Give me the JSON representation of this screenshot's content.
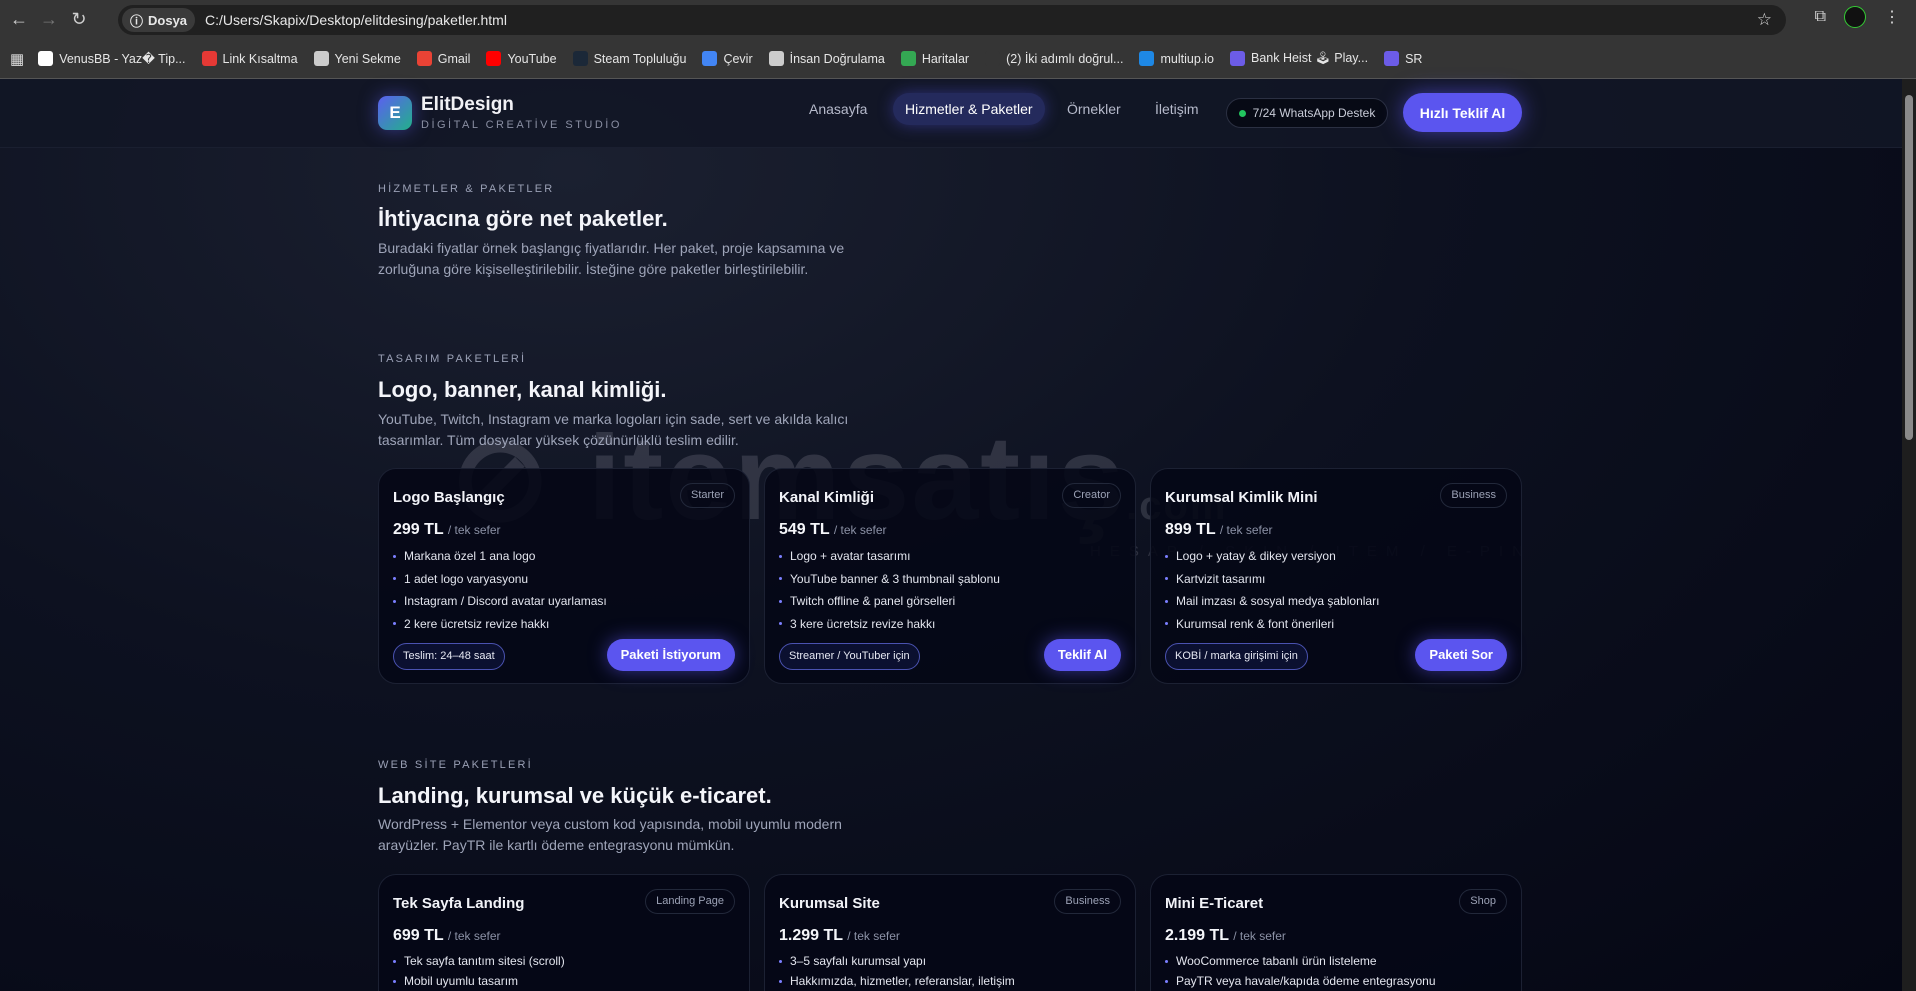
{
  "browser": {
    "chip": "Dosya",
    "url": "C:/Users/Skapix/Desktop/elitdesing/paketler.html",
    "bookmarks": [
      {
        "label": "VenusBB - Yaz� Tip...",
        "color": "#ffffff"
      },
      {
        "label": "Link Kısaltma",
        "color": "#e53935"
      },
      {
        "label": "Yeni Sekme",
        "color": "#cccccc"
      },
      {
        "label": "Gmail",
        "color": "#ea4335"
      },
      {
        "label": "YouTube",
        "color": "#ff0000"
      },
      {
        "label": "Steam Topluluğu",
        "color": "#1b2838"
      },
      {
        "label": "Çevir",
        "color": "#4285f4"
      },
      {
        "label": "İnsan Doğrulama",
        "color": "#cccccc"
      },
      {
        "label": "Haritalar",
        "color": "#34a853"
      },
      {
        "label": "(2) İki adımlı doğrul...",
        "color": "#353535"
      },
      {
        "label": "multiup.io",
        "color": "#1e88e5"
      },
      {
        "label": "Bank Heist 🕹 Play...",
        "color": "#6c5ce7"
      },
      {
        "label": "SR",
        "color": "#6c5ce7"
      }
    ]
  },
  "header": {
    "logo_letter": "E",
    "brand": "ElitDesign",
    "tagline": "DİGİTAL CREATİVE STUDİO",
    "nav": [
      "Anasayfa",
      "Hizmetler & Paketler",
      "Örnekler",
      "İletişim"
    ],
    "whatsapp": "7/24 WhatsApp Destek",
    "cta": "Hızlı Teklif Al"
  },
  "intro": {
    "eyebrow": "HİZMETLER & PAKETLER",
    "title": "İhtiyacına göre net paketler.",
    "text": "Buradaki fiyatlar örnek başlangıç fiyatlarıdır. Her paket, proje kapsamına ve zorluğuna göre kişiselleştirilebilir. İsteğine göre paketler birleştirilebilir."
  },
  "design": {
    "eyebrow": "TASARIM PAKETLERİ",
    "title": "Logo, banner, kanal kimliği.",
    "text": "YouTube, Twitch, Instagram ve marka logoları için sade, sert ve akılda kalıcı tasarımlar. Tüm dosyalar yüksek çözünürlüklü teslim edilir.",
    "cards": [
      {
        "title": "Logo Başlangıç",
        "badge": "Starter",
        "price": "299 TL",
        "per": "/ tek sefer",
        "features": [
          "Markana özel 1 ana logo",
          "1 adet logo varyasyonu",
          "Instagram / Discord avatar uyarlaması",
          "2 kere ücretsiz revize hakkı"
        ],
        "pill": "Teslim: 24–48 saat",
        "button": "Paketi İstiyorum"
      },
      {
        "title": "Kanal Kimliği",
        "badge": "Creator",
        "price": "549 TL",
        "per": "/ tek sefer",
        "features": [
          "Logo + avatar tasarımı",
          "YouTube banner & 3 thumbnail şablonu",
          "Twitch offline & panel görselleri",
          "3 kere ücretsiz revize hakkı"
        ],
        "pill": "Streamer / YouTuber için",
        "button": "Teklif Al"
      },
      {
        "title": "Kurumsal Kimlik Mini",
        "badge": "Business",
        "price": "899 TL",
        "per": "/ tek sefer",
        "features": [
          "Logo + yatay & dikey versiyon",
          "Kartvizit tasarımı",
          "Mail imzası & sosyal medya şablonları",
          "Kurumsal renk & font önerileri"
        ],
        "pill": "KOBİ / marka girişimi için",
        "button": "Paketi Sor"
      }
    ]
  },
  "web": {
    "eyebrow": "WEB SİTE PAKETLERİ",
    "title": "Landing, kurumsal ve küçük e-ticaret.",
    "text": "WordPress + Elementor veya custom kod yapısında, mobil uyumlu modern arayüzler. PayTR ile kartlı ödeme entegrasyonu mümkün.",
    "cards": [
      {
        "title": "Tek Sayfa Landing",
        "badge": "Landing Page",
        "price": "699 TL",
        "per": "/ tek sefer",
        "features": [
          "Tek sayfa tanıtım sitesi (scroll)",
          "Mobil uyumlu tasarım"
        ]
      },
      {
        "title": "Kurumsal Site",
        "badge": "Business",
        "price": "1.299 TL",
        "per": "/ tek sefer",
        "features": [
          "3–5 sayfalı kurumsal yapı",
          "Hakkımızda, hizmetler, referanslar, iletişim"
        ]
      },
      {
        "title": "Mini E-Ticaret",
        "badge": "Shop",
        "price": "2.199 TL",
        "per": "/ tek sefer",
        "features": [
          "WooCommerce tabanlı ürün listeleme",
          "PayTR veya havale/kapıda ödeme entegrasyonu"
        ]
      }
    ]
  },
  "watermark": {
    "main": "itemsatış.com",
    "sub": "HESAP / SKIN / ITEM / E-PIN"
  }
}
